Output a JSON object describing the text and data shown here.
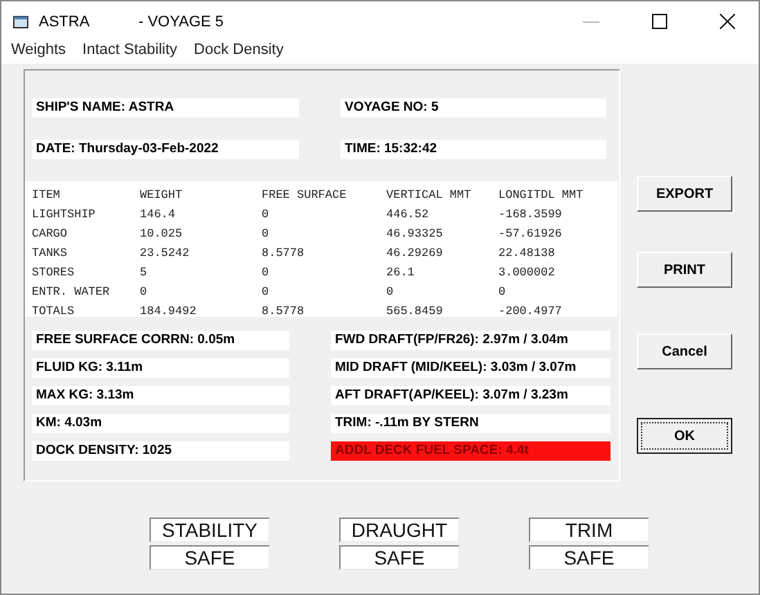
{
  "window": {
    "title": "ASTRA",
    "subtitle": "- VOYAGE  5"
  },
  "menu": [
    {
      "label": "Weights"
    },
    {
      "label": "Intact Stability"
    },
    {
      "label": "Dock Density"
    }
  ],
  "header_fields": [
    "SHIP'S NAME: ASTRA",
    "VOYAGE NO: 5",
    "DATE: Thursday-03-Feb-2022",
    "TIME: 15:32:42"
  ],
  "table": {
    "columns": [
      "ITEM",
      "WEIGHT",
      "FREE SURFACE",
      "VERTICAL MMT",
      "LONGITDL MMT"
    ],
    "rows": [
      [
        "LIGHTSHIP",
        "146.4",
        "0",
        "446.52",
        "-168.3599"
      ],
      [
        "CARGO",
        "10.025",
        "0",
        "46.93325",
        "-57.61926"
      ],
      [
        "TANKS",
        "23.5242",
        "8.5778",
        "46.29269",
        "22.48138"
      ],
      [
        "STORES",
        "5",
        "0",
        "26.1",
        "3.000002"
      ],
      [
        "ENTR. WATER",
        "0",
        "0",
        "0",
        "0"
      ],
      [
        "TOTALS",
        "184.9492",
        "8.5778",
        "565.8459",
        "-200.4977"
      ]
    ]
  },
  "stability_fields": [
    {
      "text": "FREE SURFACE CORRN: 0.05m"
    },
    {
      "text": "FLUID KG: 3.11m"
    },
    {
      "text": "MAX KG: 3.13m"
    },
    {
      "text": "KM: 4.03m"
    },
    {
      "text": "DOCK DENSITY: 1025"
    }
  ],
  "draft_fields": [
    {
      "text": "FWD DRAFT(FP/FR26): 2.97m / 3.04m",
      "alert": false
    },
    {
      "text": "MID DRAFT (MID/KEEL): 3.03m / 3.07m",
      "alert": false
    },
    {
      "text": "AFT DRAFT(AP/KEEL): 3.07m / 3.23m",
      "alert": false
    },
    {
      "text": "TRIM: -.11m BY STERN",
      "alert": false
    },
    {
      "text": "ADDL DECK FUEL SPACE: 4.4t",
      "alert": true
    }
  ],
  "buttons": [
    {
      "label": "EXPORT",
      "focused": false
    },
    {
      "label": "PRINT",
      "focused": false
    },
    {
      "label": "Cancel",
      "focused": false
    },
    {
      "label": "OK",
      "focused": true
    }
  ],
  "status": [
    {
      "label": "STABILITY",
      "value": "SAFE"
    },
    {
      "label": "DRAUGHT",
      "value": "SAFE"
    },
    {
      "label": "TRIM",
      "value": "SAFE"
    }
  ]
}
